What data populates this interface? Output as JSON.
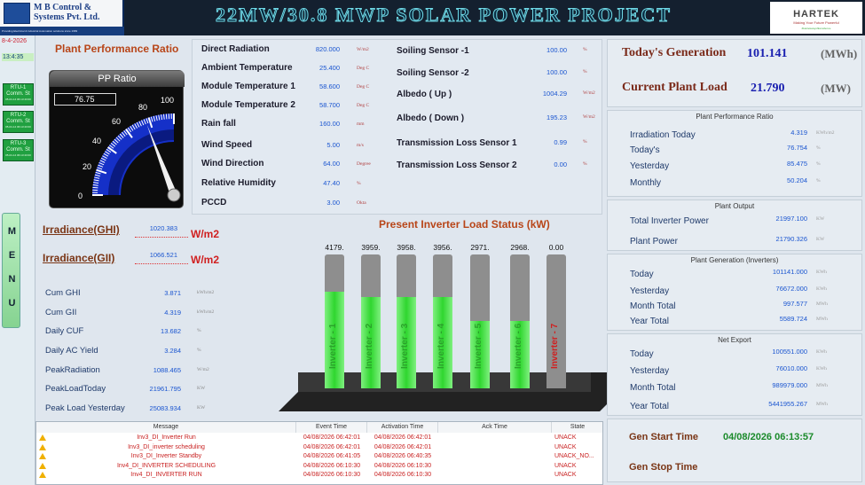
{
  "header": {
    "title": "22MW/30.8 MWP SOLAR POWER PROJECT",
    "left_logo": {
      "line1": "M B Control &",
      "line2": "Systems Pvt. Ltd.",
      "tagline": "Providing Electrical & Industrial Automation solutions since 1983"
    },
    "right_logo": {
      "name": "HARTEK",
      "tagline": "Making Your Future Powerful",
      "sub": "#HartekwayofExcellence"
    }
  },
  "sidebar": {
    "date": "8-4-2026",
    "time": "13:4:35",
    "rtu": [
      {
        "line1": "RTU-1",
        "line2": "Comm. St",
        "line3": "05-04-14 06:13:43:00"
      },
      {
        "line1": "RTU-2",
        "line2": "Comm. St",
        "line3": "05-04-14 06:13:43:00"
      },
      {
        "line1": "RTU-3",
        "line2": "Comm. St",
        "line3": "05-04-14 06:13:43:00"
      }
    ],
    "menu": [
      "M",
      "E",
      "N",
      "U"
    ]
  },
  "ppr": {
    "title": "Plant Performance Ratio",
    "gauge_title": "PP Ratio",
    "value": "76.75",
    "ticks": [
      "0",
      "20",
      "40",
      "60",
      "80",
      "100"
    ],
    "ratio": 76.75
  },
  "params_left": [
    {
      "label": "Direct Radiation",
      "value": "820.000",
      "unit": "W/m2"
    },
    {
      "label": "Ambient Temperature",
      "value": "25.400",
      "unit": "Deg C"
    },
    {
      "label": "Module Temperature 1",
      "value": "58.600",
      "unit": "Deg C"
    },
    {
      "label": "Module Temperature 2",
      "value": "58.700",
      "unit": "Deg C"
    },
    {
      "label": "Rain fall",
      "value": "160.00",
      "unit": "mm"
    },
    {
      "label": "Wind Speed",
      "value": "5.00",
      "unit": "m/s"
    },
    {
      "label": "Wind Direction",
      "value": "64.00",
      "unit": "Degree"
    },
    {
      "label": "Relative Humidity",
      "value": "47.40",
      "unit": "%"
    },
    {
      "label": "PCCD",
      "value": "3.00",
      "unit": "Okta"
    }
  ],
  "params_right": [
    {
      "label": "Soiling Sensor -1",
      "value": "100.00",
      "unit": "%"
    },
    {
      "label": "Soiling Sensor -2",
      "value": "100.00",
      "unit": "%"
    },
    {
      "label": "Albedo ( Up )",
      "value": "1004.29",
      "unit": "W/m2"
    },
    {
      "label": "Albedo ( Down )",
      "value": "195.23",
      "unit": "W/m2"
    },
    {
      "label": "Transmission Loss Sensor 1",
      "value": "0.99",
      "unit": "%"
    },
    {
      "label": "Transmission Loss Sensor 2",
      "value": "0.00",
      "unit": "%"
    }
  ],
  "irradiance": [
    {
      "label": "Irradiance(GHI)",
      "value": "1020.383",
      "unit": "W/m2"
    },
    {
      "label": "Irradiance(GII)",
      "value": "1066.521",
      "unit": "W/m2"
    }
  ],
  "cumulative": [
    {
      "label": "Cum GHI",
      "value": "3.871",
      "unit": "kWh/m2"
    },
    {
      "label": "Cum GII",
      "value": "4.319",
      "unit": "kWh/m2"
    },
    {
      "label": "Daily CUF",
      "value": "13.682",
      "unit": "%"
    },
    {
      "label": "Daily AC Yield",
      "value": "3.284",
      "unit": "%"
    },
    {
      "label": "PeakRadiation",
      "value": "1088.465",
      "unit": "W/m2"
    },
    {
      "label": "PeakLoadToday",
      "value": "21961.795",
      "unit": "KW"
    },
    {
      "label": "Peak Load Yesterday",
      "value": "25083.934",
      "unit": "KW"
    }
  ],
  "chart_data": {
    "type": "bar",
    "title": "Present Inverter Load Status (kW)",
    "categories": [
      "Inverter - 1",
      "Inverter - 2",
      "Inverter - 3",
      "Inverter - 4",
      "Inverter - 5",
      "Inverter - 6",
      "Inverter - 7"
    ],
    "values": [
      4179,
      3959,
      3958,
      3956,
      2971,
      2968,
      0
    ],
    "value_labels": [
      "4179.",
      "3959.",
      "3958.",
      "3956.",
      "2971.",
      "2968.",
      "0.00"
    ],
    "fill_fraction": [
      0.72,
      0.68,
      0.68,
      0.68,
      0.5,
      0.5,
      0
    ],
    "colors": {
      "fill": "#2fd62f",
      "empty": "#8e8e8e",
      "label_ok": "#2aa22a",
      "label_off": "#d02020"
    }
  },
  "alarms": {
    "columns": [
      "Message",
      "Event Time",
      "Activation Time",
      "Ack Time",
      "State"
    ],
    "rows": [
      {
        "message": "Inv3_DI_Inverter Run",
        "event": "04/08/2026 06:42:01",
        "activation": "04/08/2026 06:42:01",
        "ack": "",
        "state": "UNACK"
      },
      {
        "message": "Inv3_DI_inverter scheduling",
        "event": "04/08/2026 06:42:01",
        "activation": "04/08/2026 06:42:01",
        "ack": "",
        "state": "UNACK"
      },
      {
        "message": "Inv3_DI_Inverter Standby",
        "event": "04/08/2026 06:41:05",
        "activation": "04/08/2026 06:40:35",
        "ack": "",
        "state": "UNACK_NO..."
      },
      {
        "message": "Inv4_DI_INVERTER SCHEDULING",
        "event": "04/08/2026 06:10:30",
        "activation": "04/08/2026 06:10:30",
        "ack": "",
        "state": "UNACK"
      },
      {
        "message": "Inv4_DI_INVERTER RUN",
        "event": "04/08/2026 06:10:30",
        "activation": "04/08/2026 06:10:30",
        "ack": "",
        "state": "UNACK"
      }
    ]
  },
  "right": {
    "today_gen": {
      "label": "Today's Generation",
      "value": "101.141",
      "unit": "(MWh)"
    },
    "plant_load": {
      "label": "Current Plant Load",
      "value": "21.790",
      "unit": "(MW)"
    },
    "pr_panel": {
      "title": "Plant Performance Ratio",
      "rows": [
        {
          "label": "Irradiation Today",
          "value": "4.319",
          "unit": "KWh/m2"
        },
        {
          "label": "Today's",
          "value": "76.754",
          "unit": "%"
        },
        {
          "label": "Yesterday",
          "value": "85.475",
          "unit": "%"
        },
        {
          "label": "Monthly",
          "value": "50.204",
          "unit": "%"
        }
      ]
    },
    "output_panel": {
      "title": "Plant Output",
      "rows": [
        {
          "label": "Total Inverter Power",
          "value": "21997.100",
          "unit": "KW"
        },
        {
          "label": "Plant Power",
          "value": "21790.326",
          "unit": "KW"
        }
      ]
    },
    "gen_panel": {
      "title": "Plant Generation (Inverters)",
      "rows": [
        {
          "label": "Today",
          "value": "101141.000",
          "unit": "KWh"
        },
        {
          "label": "Yesterday",
          "value": "76672.000",
          "unit": "KWh"
        },
        {
          "label": "Month Total",
          "value": "997.577",
          "unit": "MWh"
        },
        {
          "label": "Year Total",
          "value": "5589.724",
          "unit": "MWh"
        }
      ]
    },
    "export_panel": {
      "title": "Net Export",
      "rows": [
        {
          "label": "Today",
          "value": "100551.000",
          "unit": "KWh"
        },
        {
          "label": "Yesterday",
          "value": "76010.000",
          "unit": "KWh"
        },
        {
          "label": "Month Total",
          "value": "989979.000",
          "unit": "MWh"
        },
        {
          "label": "Year Total",
          "value": "5441955.267",
          "unit": "MWh"
        }
      ]
    },
    "gen_start": {
      "label": "Gen Start Time",
      "value": "04/08/2026 06:13:57"
    },
    "gen_stop": {
      "label": "Gen Stop Time",
      "value": ""
    }
  }
}
